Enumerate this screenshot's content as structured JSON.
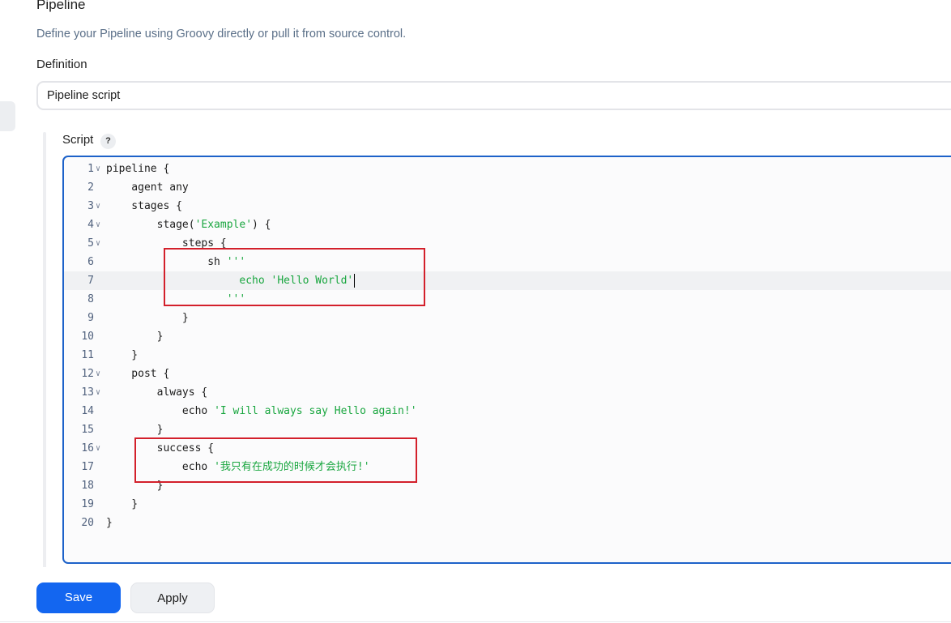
{
  "section": {
    "title": "Pipeline",
    "description": "Define your Pipeline using Groovy directly or pull it from source control."
  },
  "definition": {
    "label": "Definition",
    "selected": "Pipeline script"
  },
  "script": {
    "label": "Script",
    "help": "?",
    "active_line": 7,
    "lines": [
      {
        "n": "1",
        "fold": true,
        "code": "pipeline {",
        "str": "",
        "tail": ""
      },
      {
        "n": "2",
        "fold": false,
        "code": "    agent any",
        "str": "",
        "tail": ""
      },
      {
        "n": "3",
        "fold": true,
        "code": "    stages {",
        "str": "",
        "tail": ""
      },
      {
        "n": "4",
        "fold": true,
        "code": "        stage(",
        "str": "'Example'",
        "tail": ") {"
      },
      {
        "n": "5",
        "fold": true,
        "code": "            steps {",
        "str": "",
        "tail": ""
      },
      {
        "n": "6",
        "fold": false,
        "code": "                sh ",
        "str": "'''",
        "tail": ""
      },
      {
        "n": "7",
        "fold": false,
        "code": "                     ",
        "str": "echo 'Hello World'",
        "tail": ""
      },
      {
        "n": "8",
        "fold": false,
        "code": "                   ",
        "str": "'''",
        "tail": ""
      },
      {
        "n": "9",
        "fold": false,
        "code": "            }",
        "str": "",
        "tail": ""
      },
      {
        "n": "10",
        "fold": false,
        "code": "        }",
        "str": "",
        "tail": ""
      },
      {
        "n": "11",
        "fold": false,
        "code": "    }",
        "str": "",
        "tail": ""
      },
      {
        "n": "12",
        "fold": true,
        "code": "    post {",
        "str": "",
        "tail": ""
      },
      {
        "n": "13",
        "fold": true,
        "code": "        always {",
        "str": "",
        "tail": ""
      },
      {
        "n": "14",
        "fold": false,
        "code": "            echo ",
        "str": "'I will always say Hello again!'",
        "tail": ""
      },
      {
        "n": "15",
        "fold": false,
        "code": "        }",
        "str": "",
        "tail": ""
      },
      {
        "n": "16",
        "fold": true,
        "code": "        success {",
        "str": "",
        "tail": ""
      },
      {
        "n": "17",
        "fold": false,
        "code": "            echo ",
        "str": "'我只有在成功的时候才会执行!'",
        "tail": ""
      },
      {
        "n": "18",
        "fold": false,
        "code": "        }",
        "str": "",
        "tail": ""
      },
      {
        "n": "19",
        "fold": false,
        "code": "    }",
        "str": "",
        "tail": ""
      },
      {
        "n": "20",
        "fold": false,
        "code": "}",
        "str": "",
        "tail": ""
      }
    ]
  },
  "buttons": {
    "save": "Save",
    "apply": "Apply"
  },
  "colors": {
    "primary": "#1366f0",
    "editor_border": "#1d62c9",
    "string": "#19a63f",
    "annotation": "#d3202b"
  }
}
